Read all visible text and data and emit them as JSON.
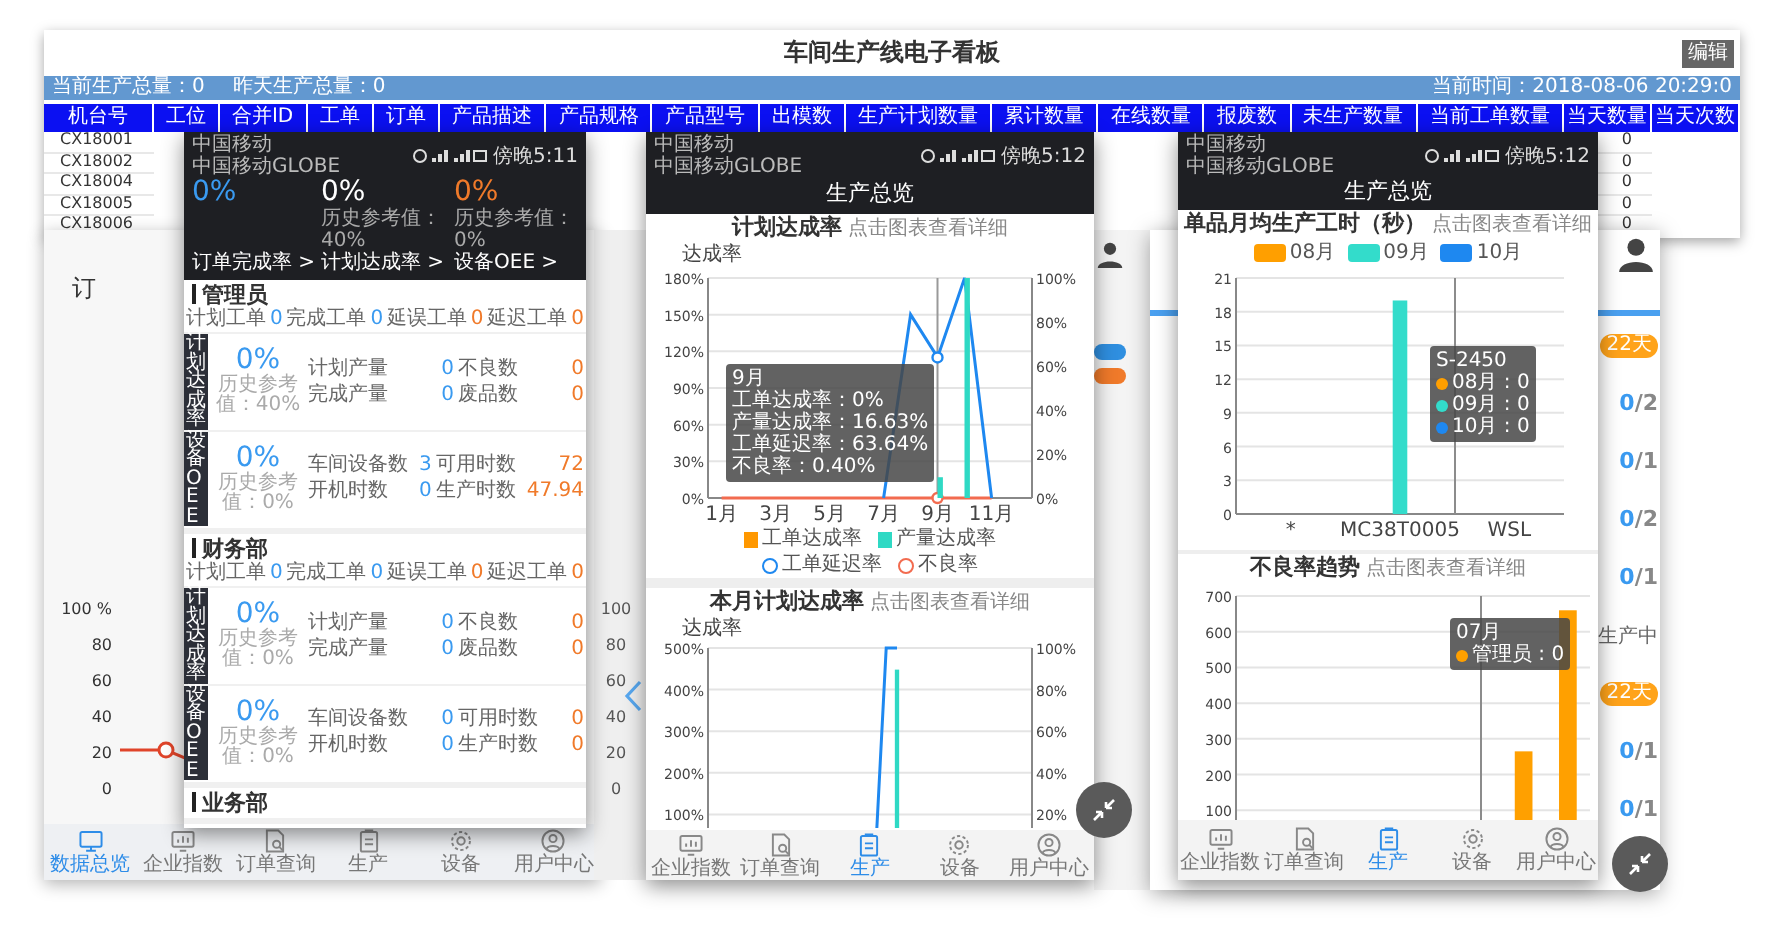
{
  "board": {
    "title": "车间生产线电子看板",
    "edit_button": "编辑",
    "totals": [
      "当前生产总量：0",
      "昨天生产总量：0"
    ],
    "current_time": "当前时间：2018-08-06 20:29:0",
    "columns": [
      "机台号",
      "工位",
      "合并ID",
      "工单",
      "订单",
      "产品描述",
      "产品规格",
      "产品型号",
      "出模数",
      "生产计划数量",
      "累计数量",
      "在线数量",
      "报废数",
      "未生产数量",
      "当前工单数量",
      "当天数量",
      "当天次数"
    ],
    "rows": [
      {
        "machine_no": "CX18001",
        "today_qty": "0"
      },
      {
        "machine_no": "CX18002",
        "today_qty": "0"
      },
      {
        "machine_no": "CX18004",
        "today_qty": "0"
      },
      {
        "machine_no": "CX18005",
        "today_qty": "0"
      },
      {
        "machine_no": "CX18006",
        "today_qty": "0"
      }
    ]
  },
  "left_card": {
    "heading": "订",
    "axis_labels": [
      "100 %",
      "80",
      "60",
      "40",
      "20",
      "0"
    ],
    "tabs": [
      {
        "label": "数据总览",
        "selected": true
      },
      {
        "label": "企业指数",
        "selected": false
      },
      {
        "label": "订单查询",
        "selected": false
      },
      {
        "label": "生产",
        "selected": false
      },
      {
        "label": "设备",
        "selected": false
      },
      {
        "label": "用户中心",
        "selected": false
      }
    ]
  },
  "middle_card": {
    "axis_labels": [
      "100",
      "80",
      "60",
      "40",
      "20",
      "0"
    ]
  },
  "right_card": {
    "items": [
      {
        "kind": "pill",
        "text": "22天"
      },
      {
        "kind": "count",
        "done": "0",
        "total": "/2"
      },
      {
        "kind": "count",
        "done": "0",
        "total": "/1"
      },
      {
        "kind": "count",
        "done": "0",
        "total": "/2"
      },
      {
        "kind": "count",
        "done": "0",
        "total": "/1"
      },
      {
        "kind": "status",
        "text": "生产中"
      },
      {
        "kind": "pill",
        "text": "22天"
      },
      {
        "kind": "count",
        "done": "0",
        "total": "/1"
      },
      {
        "kind": "count",
        "done": "0",
        "total": "/1"
      }
    ]
  },
  "phone_1": {
    "status": {
      "carrier_1": "中国移动",
      "carrier_2": "中国移动GLOBE",
      "time": "傍晚5:11"
    },
    "kpis": [
      {
        "value": "0%",
        "color": "#3a9af0",
        "link": "订单完成率 >"
      },
      {
        "value": "0%",
        "color": "#ffffff",
        "history": "历史参考值：40%",
        "link": "计划达成率 >"
      },
      {
        "value": "0%",
        "color": "#f07a2a",
        "history": "历史参考值：0%",
        "link": "设备OEE >"
      }
    ],
    "sections": [
      {
        "name": "管理员",
        "summary": [
          {
            "label": "计划工单",
            "value": "0"
          },
          {
            "label": "完成工单",
            "value": "0"
          },
          {
            "label": "延误工单",
            "value": "0"
          },
          {
            "label": "延迟工单",
            "value": "0"
          }
        ],
        "blocks": [
          {
            "label": "计划达成率",
            "value": "0%",
            "history": "历史参考值：40%",
            "stats": [
              {
                "label": "计划产量",
                "value": "0"
              },
              {
                "label": "不良数",
                "value": "0"
              },
              {
                "label": "完成产量",
                "value": "0"
              },
              {
                "label": "废品数",
                "value": "0"
              }
            ]
          },
          {
            "label": "设备OEE",
            "value": "0%",
            "history": "历史参考值：0%",
            "stats": [
              {
                "label": "车间设备数",
                "value": "3"
              },
              {
                "label": "可用时数",
                "value": "72"
              },
              {
                "label": "开机时数",
                "value": "0"
              },
              {
                "label": "生产时数",
                "value": "47.94"
              }
            ]
          }
        ]
      },
      {
        "name": "财务部",
        "summary": [
          {
            "label": "计划工单",
            "value": "0"
          },
          {
            "label": "完成工单",
            "value": "0"
          },
          {
            "label": "延误工单",
            "value": "0"
          },
          {
            "label": "延迟工单",
            "value": "0"
          }
        ],
        "blocks": [
          {
            "label": "计划达成率",
            "value": "0%",
            "history": "历史参考值：0%",
            "stats": [
              {
                "label": "计划产量",
                "value": "0"
              },
              {
                "label": "不良数",
                "value": "0"
              },
              {
                "label": "完成产量",
                "value": "0"
              },
              {
                "label": "废品数",
                "value": "0"
              }
            ]
          },
          {
            "label": "设备OEE",
            "value": "0%",
            "history": "历史参考值：0%",
            "stats": [
              {
                "label": "车间设备数",
                "value": "0"
              },
              {
                "label": "可用时数",
                "value": "0"
              },
              {
                "label": "开机时数",
                "value": "0"
              },
              {
                "label": "生产时数",
                "value": "0"
              }
            ]
          }
        ]
      },
      {
        "name": "业务部"
      }
    ]
  },
  "phone_2": {
    "status": {
      "carrier_1": "中国移动",
      "carrier_2": "中国移动GLOBE",
      "time": "傍晚5:12"
    },
    "title": "生产总览",
    "charts": [
      {
        "title": "计划达成率",
        "hint": "点击图表查看详细",
        "axis_title": "达成率",
        "tooltip": {
          "title": "9月",
          "lines": [
            {
              "text": "工单达成率：0%"
            },
            {
              "text": "产量达成率：16.63%"
            },
            {
              "text": "工单延迟率：63.64%"
            },
            {
              "text": "不良率：0.40%"
            }
          ]
        },
        "chart_data": {
          "type": "bar",
          "grid": true,
          "x": [
            1,
            2,
            3,
            4,
            5,
            6,
            7,
            8,
            9,
            10,
            11
          ],
          "xlim": [
            0.5,
            12.5
          ],
          "xticks": [
            {
              "value": 1,
              "label": "1月"
            },
            {
              "value": 3,
              "label": "3月"
            },
            {
              "value": 5,
              "label": "5月"
            },
            {
              "value": 7,
              "label": "7月"
            },
            {
              "value": 9,
              "label": "9月"
            },
            {
              "value": 11,
              "label": "11月"
            }
          ],
          "ylim": [
            0,
            180
          ],
          "yticks": [
            {
              "value": 0,
              "label": "0%"
            },
            {
              "value": 30,
              "label": "30%"
            },
            {
              "value": 60,
              "label": "60%"
            },
            {
              "value": 90,
              "label": "90%"
            },
            {
              "value": 120,
              "label": "120%"
            },
            {
              "value": 150,
              "label": "150%"
            },
            {
              "value": 180,
              "label": "180%"
            }
          ],
          "y2lim": [
            0,
            100
          ],
          "y2ticks": [
            {
              "value": 0,
              "label": "0%"
            },
            {
              "value": 20,
              "label": "20%"
            },
            {
              "value": 40,
              "label": "40%"
            },
            {
              "value": 60,
              "label": "60%"
            },
            {
              "value": 80,
              "label": "80%"
            },
            {
              "value": 100,
              "label": "100%"
            }
          ],
          "ref_lines": [
            {
              "axis": "x",
              "value": 9
            }
          ],
          "series": [
            {
              "name": "工单达成率",
              "color": "#ff9800",
              "values": [
                0,
                0,
                0,
                0,
                0,
                0,
                0,
                0,
                0,
                0,
                0
              ]
            },
            {
              "name": "产量达成率",
              "color": "#2fd9c4",
              "values": [
                0,
                0,
                0,
                0,
                0,
                0,
                0,
                0,
                17,
                180,
                0
              ]
            },
            {
              "name": "工单延迟率",
              "type": "line",
              "color": "#1e88f0",
              "values": [
                null,
                null,
                null,
                null,
                null,
                null,
                0,
                150,
                115,
                180,
                0
              ]
            },
            {
              "name": "不良率",
              "type": "line",
              "color": "#f26b4f",
              "values": [
                0,
                0,
                0,
                0,
                0,
                0,
                0,
                0,
                0,
                0,
                0
              ]
            }
          ]
        }
      },
      {
        "title": "本月计划达成率",
        "hint": "点击图表查看详细",
        "axis_title": "达成率",
        "chart_data": {
          "type": "line",
          "grid": true,
          "categories": [
            null,
            null,
            null,
            null,
            null,
            null,
            null,
            null,
            null,
            null,
            null,
            null,
            null,
            null,
            null,
            null,
            null,
            null,
            null,
            null,
            null,
            null,
            null,
            null,
            null,
            null,
            null,
            null,
            null,
            null
          ],
          "ylim": [
            0,
            500
          ],
          "yticks": [
            {
              "value": 100,
              "label": "100%"
            },
            {
              "value": 200,
              "label": "200%"
            },
            {
              "value": 300,
              "label": "300%"
            },
            {
              "value": 400,
              "label": "400%"
            },
            {
              "value": 500,
              "label": "500%"
            }
          ],
          "y2lim": [
            0,
            100
          ],
          "y2ticks": [
            {
              "value": 20,
              "label": "20%"
            },
            {
              "value": 40,
              "label": "40%"
            },
            {
              "value": 60,
              "label": "60%"
            },
            {
              "value": 80,
              "label": "80%"
            },
            {
              "value": 100,
              "label": "100%"
            }
          ],
          "series": [
            {
              "color": "#1e88f0",
              "values": [
                null,
                null,
                null,
                null,
                null,
                null,
                null,
                null,
                null,
                null,
                null,
                null,
                null,
                null,
                null,
                0,
                500,
                500,
                null,
                null,
                null,
                null,
                null,
                null,
                null,
                null,
                null,
                null,
                null,
                null
              ]
            },
            {
              "type": "bar",
              "color": "#2fd9c4",
              "values": [
                null,
                null,
                null,
                null,
                null,
                null,
                null,
                null,
                null,
                null,
                null,
                null,
                null,
                null,
                null,
                null,
                null,
                448,
                null,
                null,
                null,
                null,
                null,
                null,
                null,
                null,
                null,
                null,
                null,
                null
              ]
            }
          ]
        }
      }
    ],
    "tabs": [
      {
        "label": "企业指数",
        "selected": false
      },
      {
        "label": "订单查询",
        "selected": false
      },
      {
        "label": "生产",
        "selected": true
      },
      {
        "label": "设备",
        "selected": false
      },
      {
        "label": "用户中心",
        "selected": false
      }
    ]
  },
  "phone_3": {
    "status": {
      "carrier_1": "中国移动",
      "carrier_2": "中国移动GLOBE",
      "time": "傍晚5:12"
    },
    "title": "生产总览",
    "charts": [
      {
        "title": "单品月均生产工时（秒）",
        "hint": "点击图表查看详细",
        "tooltip": {
          "title": "S-2450",
          "lines": [
            {
              "text": "08月 : 0",
              "color": "#ff9f00"
            },
            {
              "text": "09月 : 0",
              "color": "#33dccb"
            },
            {
              "text": "10月 : 0",
              "color": "#1e88f0"
            }
          ]
        },
        "chart_data": {
          "type": "bar",
          "grid": true,
          "categories": [
            "*",
            "MC38T0005",
            "WSL"
          ],
          "ylim": [
            0,
            21
          ],
          "yticks": [
            0,
            3,
            6,
            9,
            12,
            15,
            18,
            21
          ],
          "series": [
            {
              "name": "08月",
              "color": "#ff9f00",
              "values": [
                0,
                0,
                0
              ]
            },
            {
              "name": "09月",
              "color": "#33dccb",
              "values": [
                0,
                19,
                0
              ]
            },
            {
              "name": "10月",
              "color": "#1e88f0",
              "values": [
                0,
                0,
                0
              ]
            }
          ]
        }
      },
      {
        "title": "不良率趋势",
        "hint": "点击图表查看详细",
        "tooltip": {
          "title": "07月",
          "lines": [
            {
              "text": "管理员 : 0",
              "color": "#ffa000"
            }
          ]
        },
        "chart_data": {
          "type": "bar",
          "grid": true,
          "categories": [
            null,
            null,
            null,
            null,
            null,
            null,
            null,
            null
          ],
          "ylim": [
            0,
            700
          ],
          "yticks": [
            100,
            200,
            300,
            400,
            500,
            600,
            700
          ],
          "series": [
            {
              "color": "#ffa000",
              "values": [
                0,
                0,
                0,
                0,
                0,
                0,
                265,
                660
              ]
            }
          ]
        }
      }
    ],
    "tabs": [
      {
        "label": "企业指数",
        "selected": false
      },
      {
        "label": "订单查询",
        "selected": false
      },
      {
        "label": "生产",
        "selected": true
      },
      {
        "label": "设备",
        "selected": false
      },
      {
        "label": "用户中心",
        "selected": false
      }
    ]
  }
}
